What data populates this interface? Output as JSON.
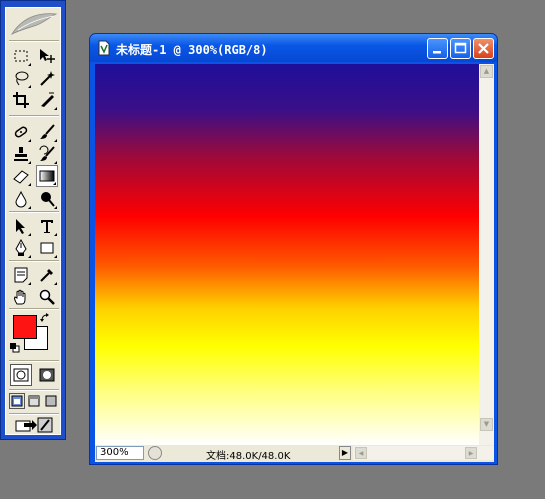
{
  "toolbox": {
    "tools": [
      {
        "name": "rect-marquee-tool",
        "icon": "marquee-icon"
      },
      {
        "name": "move-tool",
        "icon": "move-icon"
      },
      {
        "name": "lasso-tool",
        "icon": "lasso-icon"
      },
      {
        "name": "magic-wand-tool",
        "icon": "magic-wand-icon"
      },
      {
        "name": "crop-tool",
        "icon": "crop-icon"
      },
      {
        "name": "slice-tool",
        "icon": "slice-icon"
      },
      {
        "name": "healing-brush-tool",
        "icon": "bandage-icon"
      },
      {
        "name": "brush-tool",
        "icon": "brush-icon"
      },
      {
        "name": "clone-stamp-tool",
        "icon": "stamp-icon"
      },
      {
        "name": "history-brush-tool",
        "icon": "history-brush-icon"
      },
      {
        "name": "eraser-tool",
        "icon": "eraser-icon"
      },
      {
        "name": "gradient-tool",
        "icon": "gradient-icon",
        "active": true
      },
      {
        "name": "blur-tool",
        "icon": "droplet-icon"
      },
      {
        "name": "dodge-tool",
        "icon": "dodge-icon"
      },
      {
        "name": "path-selection-tool",
        "icon": "arrow-icon"
      },
      {
        "name": "type-tool",
        "icon": "type-icon"
      },
      {
        "name": "pen-tool",
        "icon": "pen-icon"
      },
      {
        "name": "rectangle-tool",
        "icon": "rectangle-icon"
      },
      {
        "name": "notes-tool",
        "icon": "notes-icon"
      },
      {
        "name": "eyedropper-tool",
        "icon": "eyedropper-icon"
      },
      {
        "name": "hand-tool",
        "icon": "hand-icon"
      },
      {
        "name": "zoom-tool",
        "icon": "magnifier-icon"
      }
    ],
    "foreground_color": "#ff1414",
    "background_color": "#ffffff"
  },
  "document": {
    "title": "未标题-1 @ 300%(RGB/8)",
    "zoom": "300%",
    "doc_info": "文档:48.0K/48.0K",
    "gradient_colors": [
      "#1f0f9a",
      "#ff0000",
      "#ffff00",
      "#ffffff"
    ]
  },
  "window_colors": {
    "titlebar": "#0a57e6",
    "close": "#d9421a",
    "desktop": "#7a7a7a"
  }
}
